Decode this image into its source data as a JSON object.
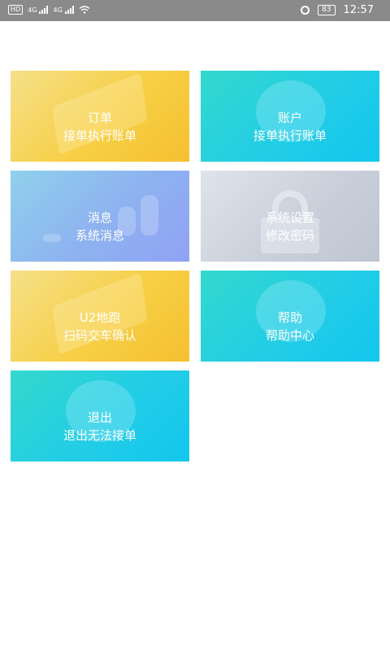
{
  "status_bar": {
    "hd": "HD",
    "sim1": "4G",
    "sim2": "4G",
    "battery": "83",
    "time": "12:57"
  },
  "tiles": [
    {
      "title": "订单",
      "subtitle": "接单执行账单"
    },
    {
      "title": "账户",
      "subtitle": "接单执行账单"
    },
    {
      "title": "消息",
      "subtitle": "系统消息"
    },
    {
      "title": "系统设置",
      "subtitle": "修改密码"
    },
    {
      "title": "U2地跑",
      "subtitle": "扫码交车确认"
    },
    {
      "title": "帮助",
      "subtitle": "帮助中心"
    },
    {
      "title": "退出",
      "subtitle": "退出无法接单"
    }
  ],
  "colors": {
    "status_bar": "#8a8a8a",
    "tile_yellow": "#f7cf45",
    "tile_cyan": "#22cde6",
    "tile_blue": "#8eb2f0",
    "tile_gray": "#c8ced9"
  }
}
